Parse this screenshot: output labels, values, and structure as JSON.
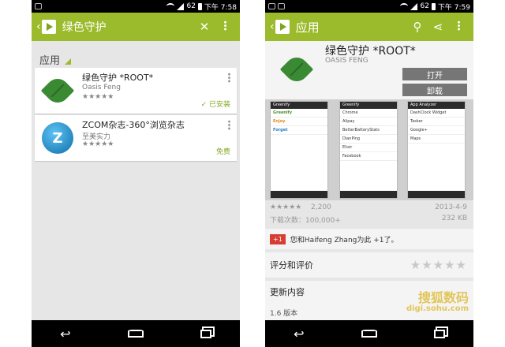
{
  "left": {
    "status": {
      "signal": "62",
      "time": "下午 7:58"
    },
    "search": {
      "query": "绿色守护"
    },
    "section": {
      "label": "应用"
    },
    "apps": [
      {
        "name": "绿色守护 *ROOT*",
        "developer": "Oasis Feng",
        "rating": "★★★★★",
        "badge": "✓ 已安装",
        "icon": "leaf-icon"
      },
      {
        "name": "ZCOM杂志-360°浏览杂志",
        "developer": "至美实力",
        "rating": "★★★★★",
        "badge": "免费",
        "icon": "zcom-icon"
      }
    ]
  },
  "right": {
    "status": {
      "signal": "62",
      "time": "下午 7:59"
    },
    "actionbar": {
      "title": "应用"
    },
    "app": {
      "title": "绿色守护 *ROOT*",
      "developer": "OASIS FENG",
      "open_label": "打开",
      "uninstall_label": "卸载"
    },
    "screens": [
      {
        "header": "Greenify",
        "rows": [
          "Greenify",
          "Enjoy",
          "Forget"
        ]
      },
      {
        "header": "Greenify",
        "rows": [
          "Chrome",
          "Alipay",
          "BetterBatteryStats",
          "DianPing",
          "Elixir",
          "Facebook"
        ]
      },
      {
        "header": "App Analyzer",
        "rows": [
          "DashClock Widget",
          "Tasker",
          "Google+",
          "Maps"
        ]
      }
    ],
    "meta": {
      "rating_count": "2,200",
      "date": "2013-4-9",
      "downloads": "下载次数：100,000+",
      "size": "232 KB"
    },
    "plus_one": {
      "badge": "+1",
      "text": "您和Haifeng Zhang为此 +1了。"
    },
    "reviews": {
      "label": "评分和评价",
      "stars": "★★★★★"
    },
    "whats_new": {
      "label": "更新内容",
      "version": "1.6 版本"
    },
    "watermark": {
      "line1": "搜狐数码",
      "line2": "digi.sohu.com"
    }
  },
  "colors": {
    "accent": "#9bbb2c",
    "background": "#e6e6e6"
  }
}
